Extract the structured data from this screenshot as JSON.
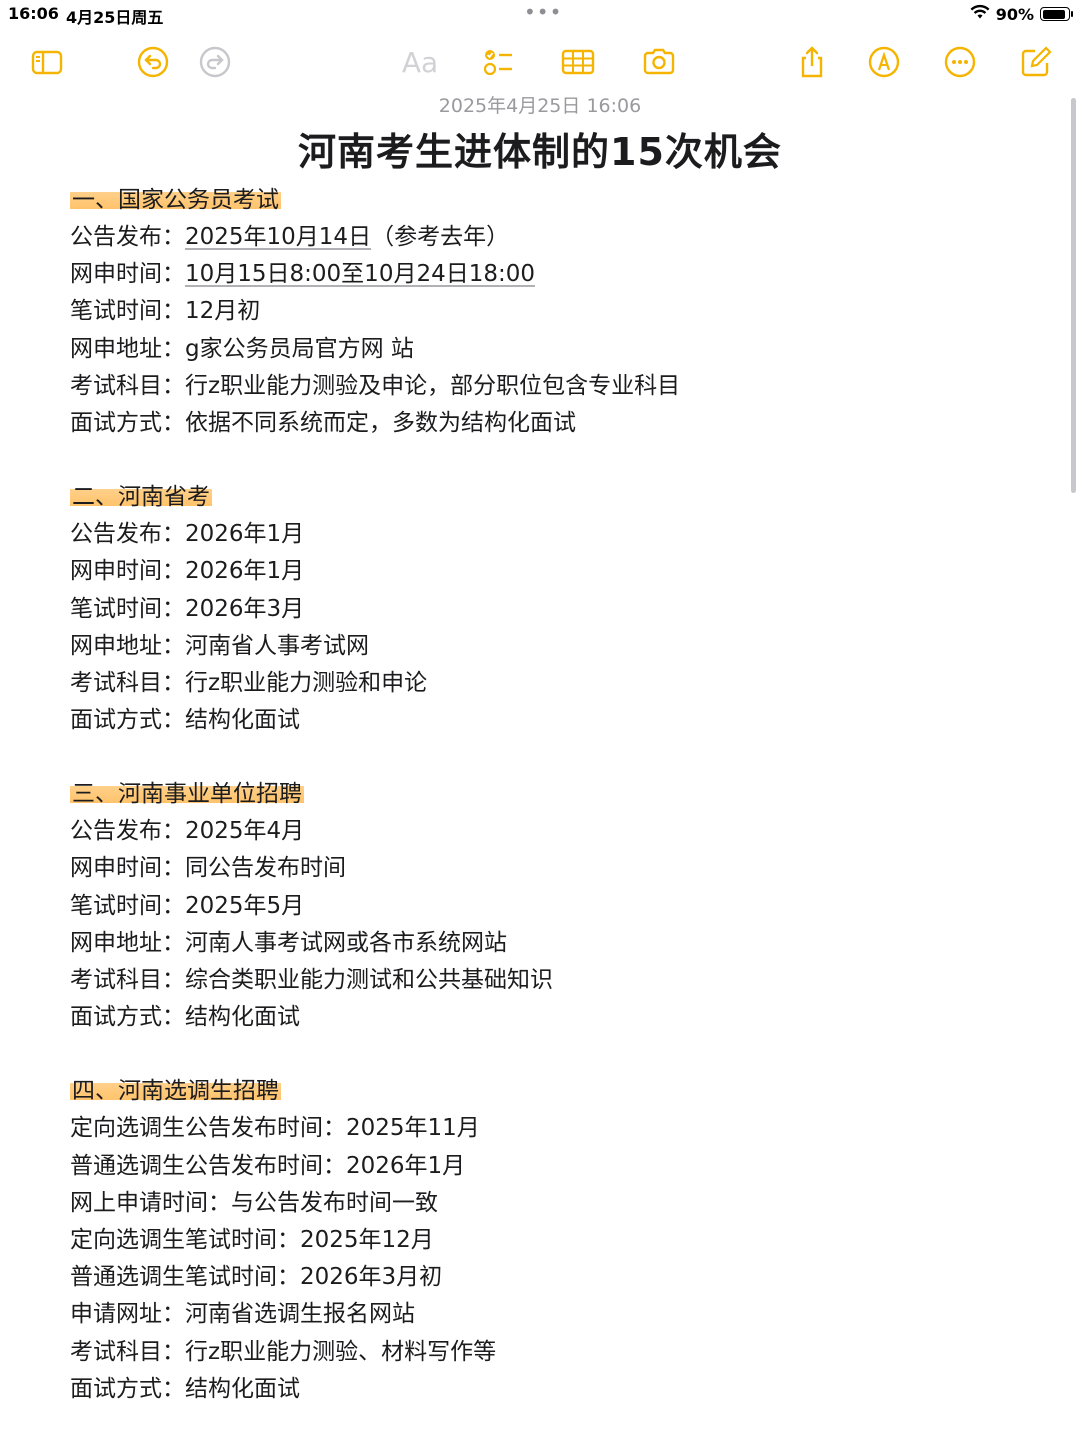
{
  "status_bar": {
    "time": "16:06",
    "date": "4月25日周五",
    "battery": "90%",
    "battery_level": 0.9
  },
  "toolbar": {
    "format_label": "Aa",
    "accent_color": "#f5b400"
  },
  "note": {
    "timestamp": "2025年4月25日 16:06",
    "title": "河南考生进体制的15次机会",
    "sections": [
      {
        "heading": "一、国家公务员考试",
        "rows": [
          {
            "label": "公告发布：",
            "value": "2025年10月14日",
            "note": "（参考去年）"
          },
          {
            "label": "网申时间：",
            "value": "10月15日8:00至10月24日18:00"
          },
          {
            "label": "笔试时间：",
            "value": "12月初"
          },
          {
            "label": "网申地址：",
            "value": "g家公务员局官方网 站"
          },
          {
            "label": "考试科目：",
            "value": "行z职业能力测验及申论，部分职位包含专业科目"
          },
          {
            "label": "面试方式：",
            "value": "依据不同系统而定，多数为结构化面试"
          }
        ]
      },
      {
        "heading": "二、河南省考",
        "rows": [
          {
            "label": "公告发布：",
            "value": "2026年1月"
          },
          {
            "label": "网申时间：",
            "value": "2026年1月"
          },
          {
            "label": "笔试时间：",
            "value": "2026年3月"
          },
          {
            "label": "网申地址：",
            "value": "河南省人事考试网"
          },
          {
            "label": "考试科目：",
            "value": "行z职业能力测验和申论"
          },
          {
            "label": "面试方式：",
            "value": "结构化面试"
          }
        ]
      },
      {
        "heading": "三、河南事业单位招聘",
        "rows": [
          {
            "label": "公告发布：",
            "value": "2025年4月"
          },
          {
            "label": "网申时间：",
            "value": "同公告发布时间"
          },
          {
            "label": "笔试时间：",
            "value": "2025年5月"
          },
          {
            "label": "网申地址：",
            "value": "河南人事考试网或各市系统网站"
          },
          {
            "label": "考试科目：",
            "value": "综合类职业能力测试和公共基础知识"
          },
          {
            "label": "面试方式：",
            "value": "结构化面试"
          }
        ]
      },
      {
        "heading": "四、河南选调生招聘",
        "rows": [
          {
            "label": "定向选调生公告发布时间：",
            "value": "2025年11月"
          },
          {
            "label": "普通选调生公告发布时间：",
            "value": "2026年1月"
          },
          {
            "label": "网上申请时间：",
            "value": "与公告发布时间一致"
          },
          {
            "label": "定向选调生笔试时间：",
            "value": "2025年12月"
          },
          {
            "label": "普通选调生笔试时间：",
            "value": "2026年3月初"
          },
          {
            "label": "申请网址：",
            "value": "河南省选调生报名网站"
          },
          {
            "label": "考试科目：",
            "value": "行z职业能力测验、材料写作等"
          },
          {
            "label": "面试方式：",
            "value": "结构化面试"
          }
        ]
      }
    ]
  }
}
